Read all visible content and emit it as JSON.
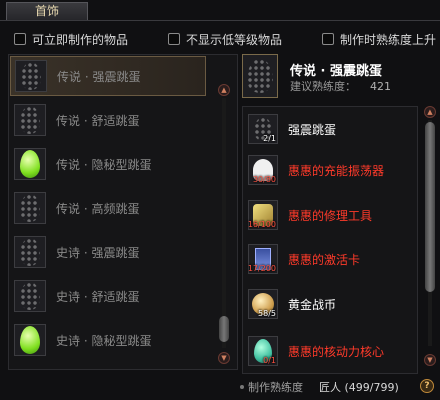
{
  "tab": {
    "label": "首饰"
  },
  "filters": [
    {
      "label": "可立即制作的物品",
      "checked": false
    },
    {
      "label": "不显示低等级物品",
      "checked": false
    },
    {
      "label": "制作时熟练度上升",
      "checked": false
    }
  ],
  "recipes": [
    {
      "label": "传说 · 强震跳蛋",
      "egg": "gold",
      "selected": true
    },
    {
      "label": "传说 · 舒适跳蛋",
      "egg": "red",
      "selected": false
    },
    {
      "label": "传说 · 隐秘型跳蛋",
      "egg": "green",
      "selected": false
    },
    {
      "label": "传说 · 高频跳蛋",
      "egg": "pink",
      "selected": false
    },
    {
      "label": "史诗 · 强震跳蛋",
      "egg": "gold",
      "selected": false
    },
    {
      "label": "史诗 · 舒适跳蛋",
      "egg": "red",
      "selected": false
    },
    {
      "label": "史诗 · 隐秘型跳蛋",
      "egg": "green",
      "selected": false
    }
  ],
  "detail": {
    "title": "传说 · 强震跳蛋",
    "proficiency_label": "建议熟练度：",
    "proficiency_value": "421"
  },
  "materials": [
    {
      "name": "强震跳蛋",
      "count": "2/1",
      "enough": true,
      "icon": "egg-icon"
    },
    {
      "name": "惠惠的充能振荡器",
      "count": "30/80",
      "enough": false,
      "icon": "ghost-icon"
    },
    {
      "name": "惠惠的修理工具",
      "count": "16/100",
      "enough": false,
      "icon": "tool-icon"
    },
    {
      "name": "惠惠的激活卡",
      "count": "17/200",
      "enough": false,
      "icon": "card-icon"
    },
    {
      "name": "黄金战币",
      "count": "58/5",
      "enough": true,
      "icon": "coin-icon"
    },
    {
      "name": "惠惠的核动力核心",
      "count": "0/1",
      "enough": false,
      "icon": "core-icon"
    }
  ],
  "footer": {
    "label": "制作熟练度",
    "value": "匠人 (499/799)",
    "help": "?"
  },
  "scroll": {
    "up": "▲",
    "down": "▼"
  }
}
